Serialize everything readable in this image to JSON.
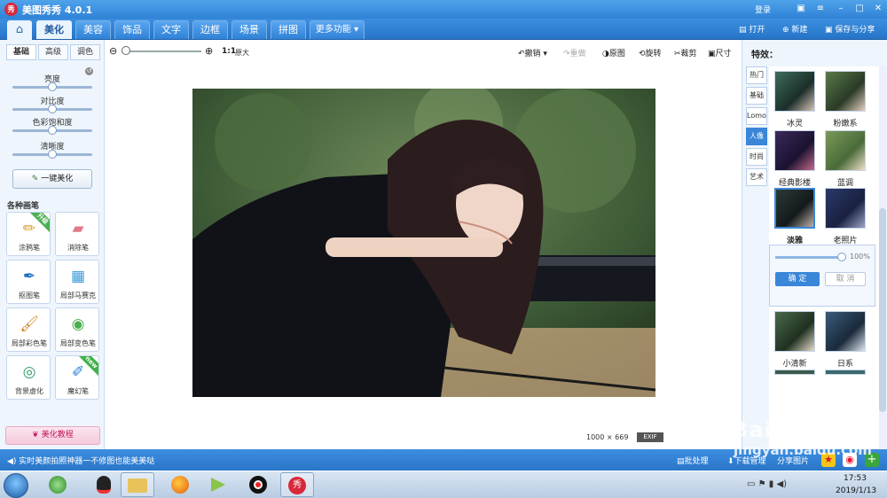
{
  "app": {
    "title": "美图秀秀 4.0.1",
    "logo_text": "秀",
    "login": "登录"
  },
  "window_controls": {
    "message_icon": "message-icon",
    "menu_icon": "menu-icon",
    "minimize": "–",
    "maximize": "□",
    "close": "✕"
  },
  "menu": {
    "tabs": [
      "美化",
      "美容",
      "饰品",
      "文字",
      "边框",
      "场景",
      "拼图"
    ],
    "active_tab": "美化",
    "more": "更多功能 ▾",
    "open": "打开",
    "new": "新建",
    "save_share": "保存与分享"
  },
  "left_panel": {
    "subtabs": [
      "基础",
      "高级",
      "调色"
    ],
    "active_subtab": "基础",
    "adjustments": [
      {
        "label": "亮度",
        "value": 0.5
      },
      {
        "label": "对比度",
        "value": 0.5
      },
      {
        "label": "色彩饱和度",
        "value": 0.5
      },
      {
        "label": "清晰度",
        "value": 0.5
      }
    ],
    "one_key": "一键美化",
    "brushes_title": "各种画笔",
    "brushes": [
      {
        "label": "涂鸦笔",
        "icon": "pencil-icon",
        "badge": "升级"
      },
      {
        "label": "消除笔",
        "icon": "eraser-icon",
        "badge": ""
      },
      {
        "label": "抠图笔",
        "icon": "cutout-pen-icon",
        "badge": ""
      },
      {
        "label": "局部马赛克",
        "icon": "mosaic-icon",
        "badge": ""
      },
      {
        "label": "局部彩色笔",
        "icon": "color-brush-icon",
        "badge": ""
      },
      {
        "label": "局部变色笔",
        "icon": "paint-bucket-icon",
        "badge": ""
      },
      {
        "label": "背景虚化",
        "icon": "blur-icon",
        "badge": ""
      },
      {
        "label": "魔幻笔",
        "icon": "magic-pen-icon",
        "badge": "new"
      }
    ],
    "tutorial": "美化教程"
  },
  "toolbar": {
    "ratio": "1:1",
    "original_size": "原大",
    "undo": "撤销",
    "redo": "重做",
    "original": "原图",
    "rotate": "旋转",
    "crop": "裁剪",
    "resize": "尺寸"
  },
  "image_info": {
    "width": "1000",
    "height": "669",
    "exif": "EXIF"
  },
  "right_panel": {
    "title": "特效：",
    "categories": [
      "热门",
      "基础",
      "Lomo",
      "人像",
      "时尚",
      "艺术"
    ],
    "active_category": "人像",
    "effects": [
      "冰灵",
      "粉嫩系",
      "经典影楼",
      "蓝调",
      "淡雅",
      "老照片",
      "小清新",
      "日系"
    ],
    "selected_effect": "淡雅",
    "intensity": "100%",
    "confirm": "确 定",
    "cancel": "取 消"
  },
  "status": {
    "text": "实时美颜拍照神器一不修图也能美美哒",
    "batch": "批处理",
    "downloads": "下载管理",
    "share": "分享图片"
  },
  "taskbar": {
    "time": "17:53",
    "date": "2019/1/13"
  },
  "watermark": {
    "big": "Baidu 经验",
    "small": "jingyan.baidu.com"
  },
  "colors": {
    "accent": "#3a86d8",
    "titlebar": "#2f82d6",
    "brand_red": "#d8283a"
  }
}
